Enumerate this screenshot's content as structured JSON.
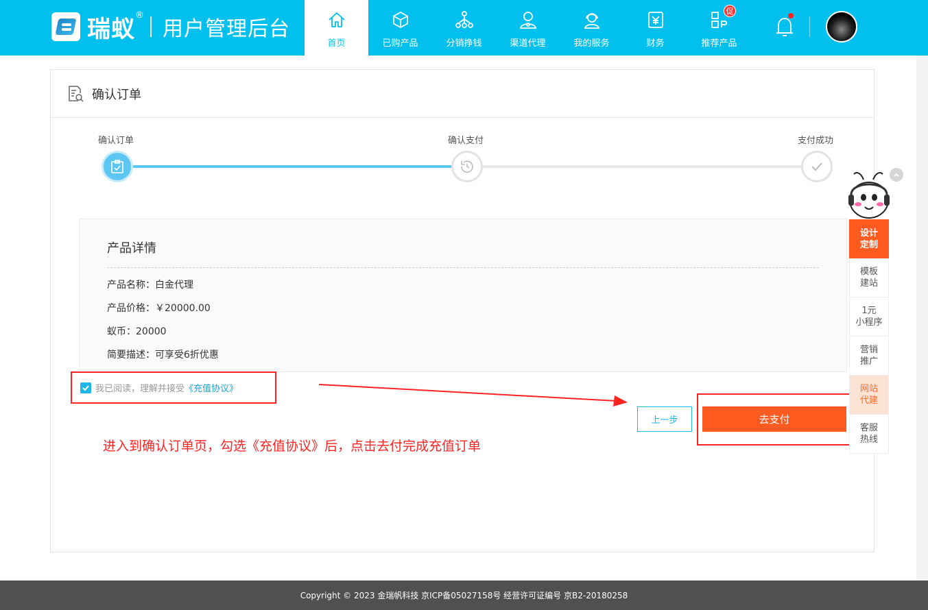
{
  "header": {
    "brand": "瑞蚁",
    "reg_mark": "®",
    "subtitle": "用户管理后台",
    "nav": [
      {
        "label": "首页",
        "icon": "home-icon"
      },
      {
        "label": "已购产品",
        "icon": "box-icon"
      },
      {
        "label": "分销挣钱",
        "icon": "share-tree-icon"
      },
      {
        "label": "渠道代理",
        "icon": "agent-user-icon"
      },
      {
        "label": "我的服务",
        "icon": "service-headset-icon"
      },
      {
        "label": "财务",
        "icon": "finance-yen-icon"
      },
      {
        "label": "推荐产品",
        "icon": "recommend-grid-icon",
        "badge": "促"
      }
    ],
    "accent_color": "#02c0ee"
  },
  "panel": {
    "title": "确认订单",
    "steps": [
      {
        "label": "确认订单",
        "state": "active"
      },
      {
        "label": "确认支付",
        "state": "pending"
      },
      {
        "label": "支付成功",
        "state": "pending"
      }
    ],
    "detail": {
      "title": "产品详情",
      "rows": [
        "产品名称：白金代理",
        "产品价格：￥20000.00",
        "蚁币：20000",
        "简要描述：可享受6折优惠"
      ]
    },
    "agreement": {
      "prefix": "我已阅读，理解并接受",
      "link": "《充值协议》",
      "checked": true
    },
    "buttons": {
      "prev": "上一步",
      "pay": "去支付"
    },
    "annotation": "进入到确认订单页，勾选《充值协议》后，点击去付完成充值订单"
  },
  "side": {
    "items": [
      "设计\n定制",
      "模板\n建站",
      "1元\n小程序",
      "营销\n推广",
      "网站\n代建",
      "客服\n热线"
    ]
  },
  "footer": {
    "text": "Copyright © 2023 金瑞帆科技 京ICP备05027158号 经营许可证编号 京B2-20180258"
  }
}
